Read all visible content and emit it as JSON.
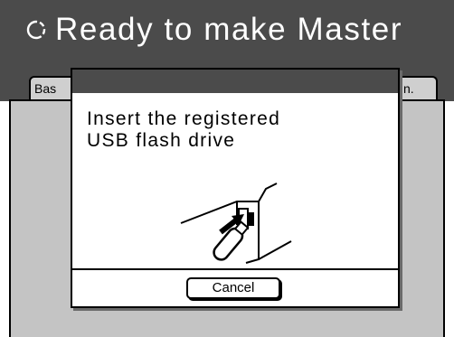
{
  "header": {
    "title": "Ready to make Master",
    "status_icon": "circle-arrows-icon"
  },
  "tabs": [
    {
      "label": "Bas"
    },
    {
      "label": "n."
    }
  ],
  "dialog": {
    "message": "Insert the registered\nUSB flash drive",
    "illustration_icon": "usb-insert-icon",
    "cancel_label": "Cancel"
  },
  "colors": {
    "bar_background": "#4b4b4b",
    "content_background": "#c4c4c4",
    "dialog_background": "#ffffff"
  }
}
